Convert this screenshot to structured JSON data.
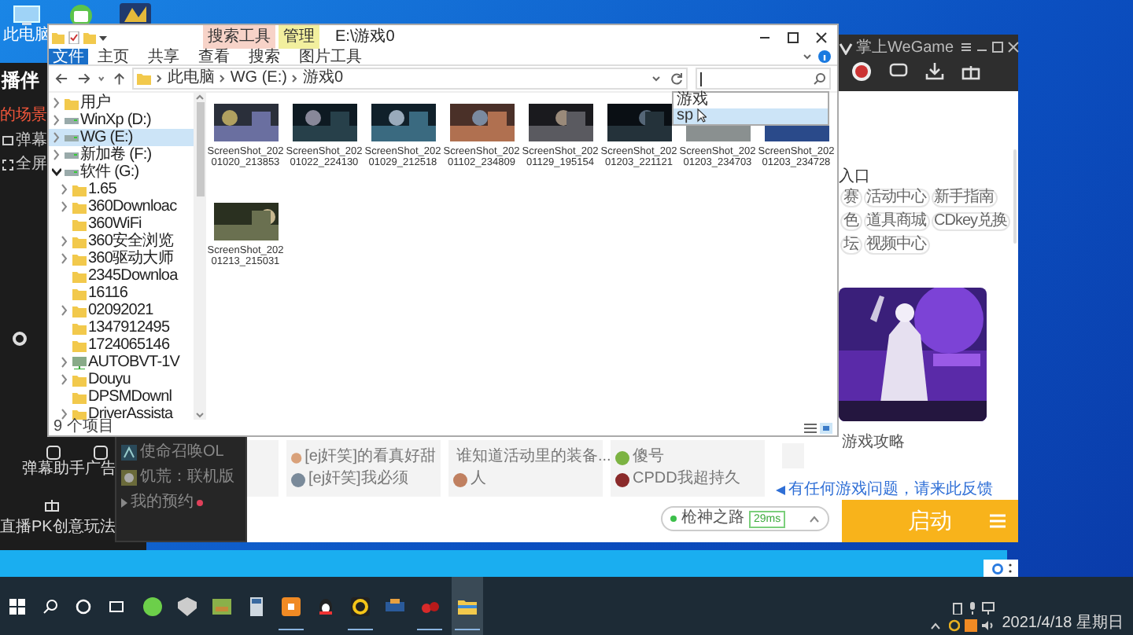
{
  "desktop": {
    "icons": [
      {
        "label": "此电脑"
      }
    ]
  },
  "stream_app": {
    "title": "播伴",
    "scene_tab": "的场景",
    "menu": [
      {
        "label": "弹幕"
      },
      {
        "label": "全屏"
      }
    ],
    "tools": [
      {
        "label": "弹幕助手"
      },
      {
        "label": "广告"
      }
    ],
    "promo": "直播PK创意玩法"
  },
  "game_popup": {
    "items": [
      {
        "label": "使命召唤OL"
      },
      {
        "label": "饥荒：联机版"
      }
    ],
    "reservations": {
      "label": "我的预约",
      "badge": true
    }
  },
  "explorer": {
    "title": "E:\\游戏0",
    "context_groups": [
      {
        "label": "搜索工具",
        "color": "#f7d3c8"
      },
      {
        "label": "管理",
        "color": "#f2ef9e"
      }
    ],
    "ribbon_tabs": [
      {
        "label": "文件",
        "kind": "file"
      },
      {
        "label": "主页",
        "kind": "tab"
      },
      {
        "label": "共享",
        "kind": "tab"
      },
      {
        "label": "查看",
        "kind": "tab"
      },
      {
        "label": "搜索",
        "kind": "context"
      },
      {
        "label": "图片工具",
        "kind": "context"
      }
    ],
    "breadcrumb": [
      "此电脑",
      "WG (E:)",
      "游戏0"
    ],
    "suggestions": [
      {
        "label": "游戏",
        "selected": false
      },
      {
        "label": "sp",
        "selected": true
      }
    ],
    "tree": [
      {
        "label": "用户",
        "kind": "folder",
        "expanded": false,
        "selected": false
      },
      {
        "label": "WinXp (D:)",
        "kind": "drive",
        "expanded": false,
        "selected": false
      },
      {
        "label": "WG (E:)",
        "kind": "drive",
        "expanded": false,
        "selected": true
      },
      {
        "label": "新加卷 (F:)",
        "kind": "drive",
        "expanded": false,
        "selected": false
      },
      {
        "label": "软件 (G:)",
        "kind": "drive",
        "expanded": true,
        "selected": false,
        "children": [
          {
            "label": "1.65",
            "kind": "folder",
            "expanded": false,
            "selected": false
          },
          {
            "label": "360Downloac",
            "kind": "folder",
            "expanded": false,
            "selected": false
          },
          {
            "label": "360WiFi",
            "kind": "folder",
            "selected": false
          },
          {
            "label": "360安全浏览",
            "kind": "folder",
            "expanded": false,
            "selected": false
          },
          {
            "label": "360驱动大师",
            "kind": "folder",
            "expanded": false,
            "selected": false
          },
          {
            "label": "2345Downloa",
            "kind": "folder",
            "selected": false
          },
          {
            "label": "16116",
            "kind": "folder",
            "selected": false
          },
          {
            "label": "02092021",
            "kind": "folder",
            "expanded": false,
            "selected": false
          },
          {
            "label": "1347912495",
            "kind": "folder",
            "selected": false
          },
          {
            "label": "1724065146",
            "kind": "folder",
            "selected": false
          },
          {
            "label": "AUTOBVT-1V",
            "kind": "network",
            "expanded": false,
            "selected": false
          },
          {
            "label": "Douyu",
            "kind": "folder",
            "expanded": false,
            "selected": false
          },
          {
            "label": "DPSMDownl",
            "kind": "folder",
            "selected": false
          },
          {
            "label": "DriverAssista",
            "kind": "folder",
            "expanded": false,
            "selected": false
          }
        ]
      }
    ],
    "files": [
      {
        "lines": [
          "ScreenShot_202",
          "01020_213853"
        ]
      },
      {
        "lines": [
          "ScreenShot_202",
          "01022_224130"
        ]
      },
      {
        "lines": [
          "ScreenShot_202",
          "01029_212518"
        ]
      },
      {
        "lines": [
          "ScreenShot_202",
          "01102_234809"
        ]
      },
      {
        "lines": [
          "ScreenShot_202",
          "01129_195154"
        ]
      },
      {
        "lines": [
          "ScreenShot_202",
          "01203_221121"
        ]
      },
      {
        "lines": [
          "ScreenShot_202",
          "01203_234703"
        ]
      },
      {
        "lines": [
          "ScreenShot_202",
          "01203_234728"
        ]
      },
      {
        "lines": [
          "ScreenShot_202",
          "01213_215031"
        ]
      }
    ],
    "status": "9 个项目"
  },
  "wegame": {
    "title": "掌上WeGame",
    "section": "入口",
    "links": [
      {
        "label": "赛"
      },
      {
        "label": "活动中心"
      },
      {
        "label": "新手指南"
      },
      {
        "label": "色"
      },
      {
        "label": "道具商城"
      },
      {
        "label": "CDkey兑换"
      },
      {
        "label": "坛"
      },
      {
        "label": "视频中心"
      }
    ],
    "guide": "游戏攻略",
    "posts": [
      {
        "entries": [
          {
            "text": "[ej奸笑]的看真好甜"
          },
          {
            "text": "[ej奸笑]我必须"
          }
        ]
      },
      {
        "entries": [
          {
            "text": "谁知道活动里的装备..."
          },
          {
            "text": "人"
          }
        ]
      },
      {
        "entries": [
          {
            "text": "傻号"
          },
          {
            "text": "CPDD我超持久"
          }
        ]
      }
    ],
    "feedback": "有任何游戏问题，请来此反馈",
    "server": {
      "name": "枪神之路",
      "ping": "29ms"
    },
    "launch": "启动"
  },
  "taskbar": {
    "date": "2021/4/18 星期日"
  }
}
